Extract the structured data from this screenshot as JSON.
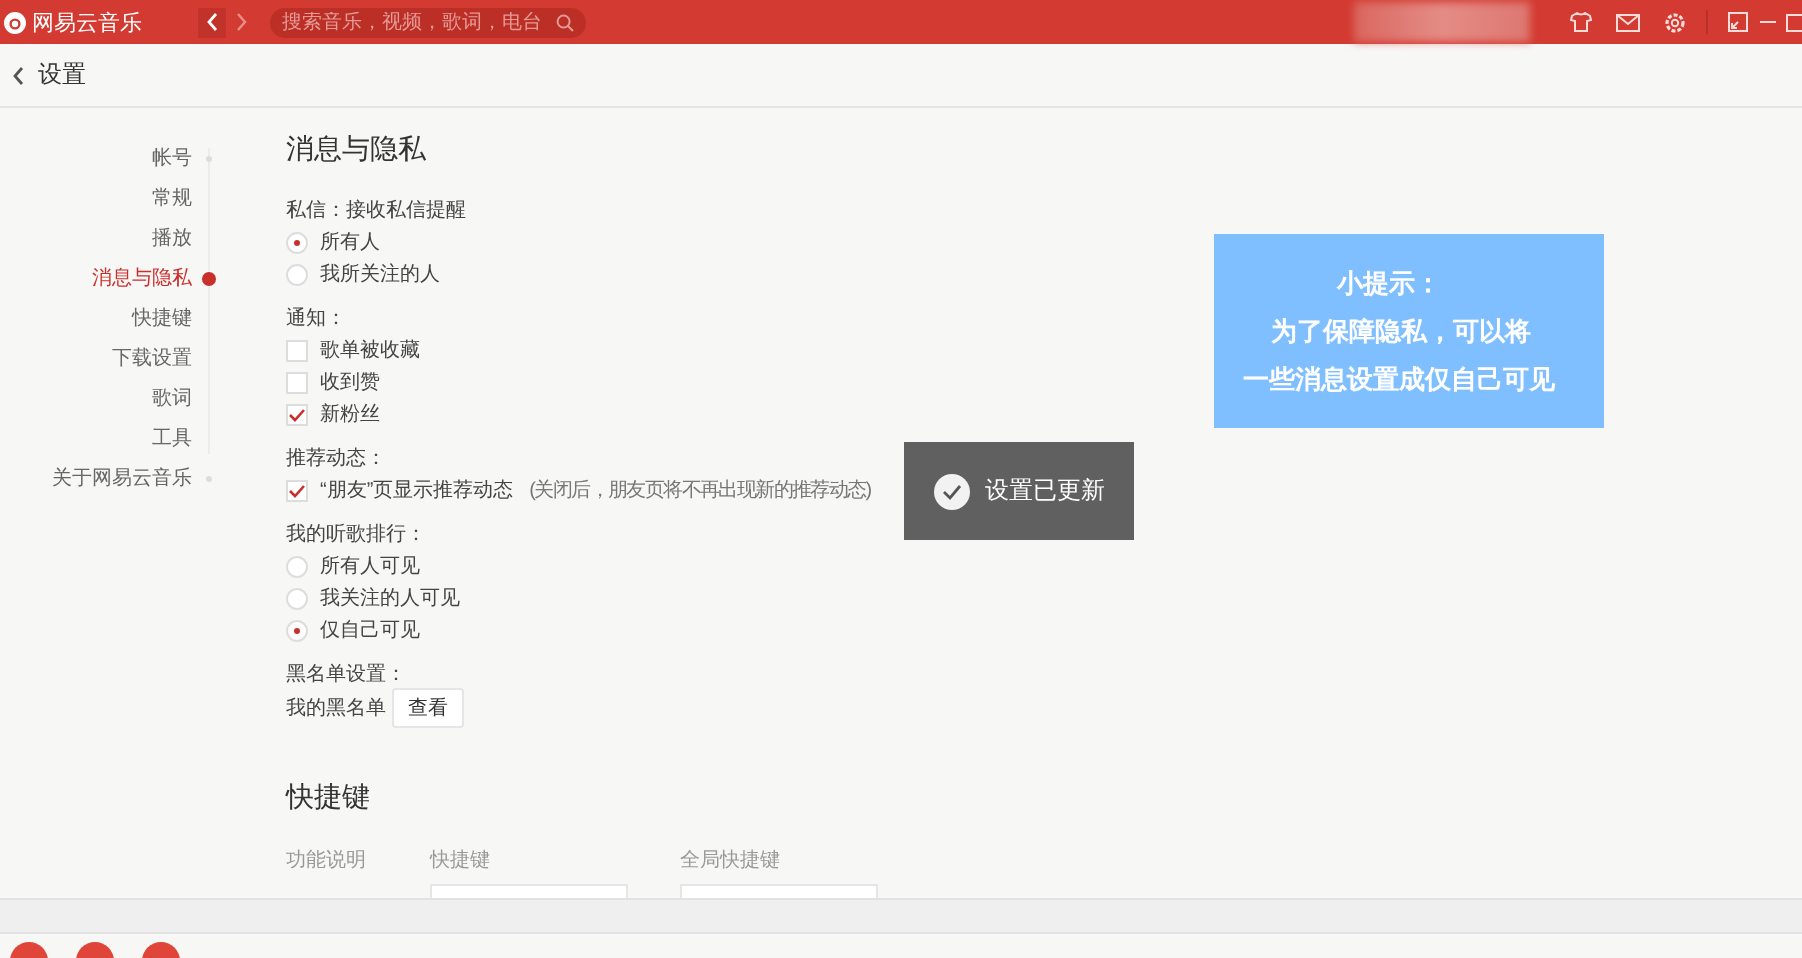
{
  "title_bar": {
    "app_name": "网易云音乐",
    "search": {
      "placeholder": "搜索音乐，视频，歌词，电台"
    }
  },
  "header": {
    "title": "设置"
  },
  "sidebar": {
    "items": [
      {
        "label": "帐号",
        "selected": false
      },
      {
        "label": "常规",
        "selected": false
      },
      {
        "label": "播放",
        "selected": false
      },
      {
        "label": "消息与隐私",
        "selected": true
      },
      {
        "label": "快捷键",
        "selected": false
      },
      {
        "label": "下载设置",
        "selected": false
      },
      {
        "label": "歌词",
        "selected": false
      },
      {
        "label": "工具",
        "selected": false
      },
      {
        "label": "关于网易云音乐",
        "selected": false
      }
    ]
  },
  "privacy": {
    "title": "消息与隐私",
    "groups": [
      {
        "label": "私信：接收私信提醒",
        "options": [
          {
            "kind": "radio",
            "label": "所有人",
            "checked": true
          },
          {
            "kind": "radio",
            "label": "我所关注的人",
            "checked": false
          }
        ]
      },
      {
        "label": "通知：",
        "options": [
          {
            "kind": "checkbox",
            "label": "歌单被收藏",
            "checked": false
          },
          {
            "kind": "checkbox",
            "label": "收到赞",
            "checked": false
          },
          {
            "kind": "checkbox",
            "label": "新粉丝",
            "checked": true
          }
        ]
      },
      {
        "label": "推荐动态：",
        "options": [
          {
            "kind": "checkbox",
            "label": "“朋友”页显示推荐动态",
            "note": "(关闭后，朋友页将不再出现新的推荐动态)",
            "checked": true
          }
        ]
      },
      {
        "label": "我的听歌排行：",
        "options": [
          {
            "kind": "radio",
            "label": "所有人可见",
            "checked": false
          },
          {
            "kind": "radio",
            "label": "我关注的人可见",
            "checked": false
          },
          {
            "kind": "radio",
            "label": "仅自己可见",
            "checked": true
          }
        ]
      }
    ],
    "blacklist": {
      "label": "黑名单设置：",
      "text": "我的黑名单",
      "button": "查看"
    }
  },
  "shortcuts": {
    "title": "快捷键",
    "columns": [
      "功能说明",
      "快捷键",
      "全局快捷键"
    ]
  },
  "toast": {
    "text": "设置已更新"
  },
  "tip": {
    "title": "小提示：",
    "lines": [
      "为了保障隐私，可以将",
      "一些消息设置成仅自己可见"
    ]
  }
}
